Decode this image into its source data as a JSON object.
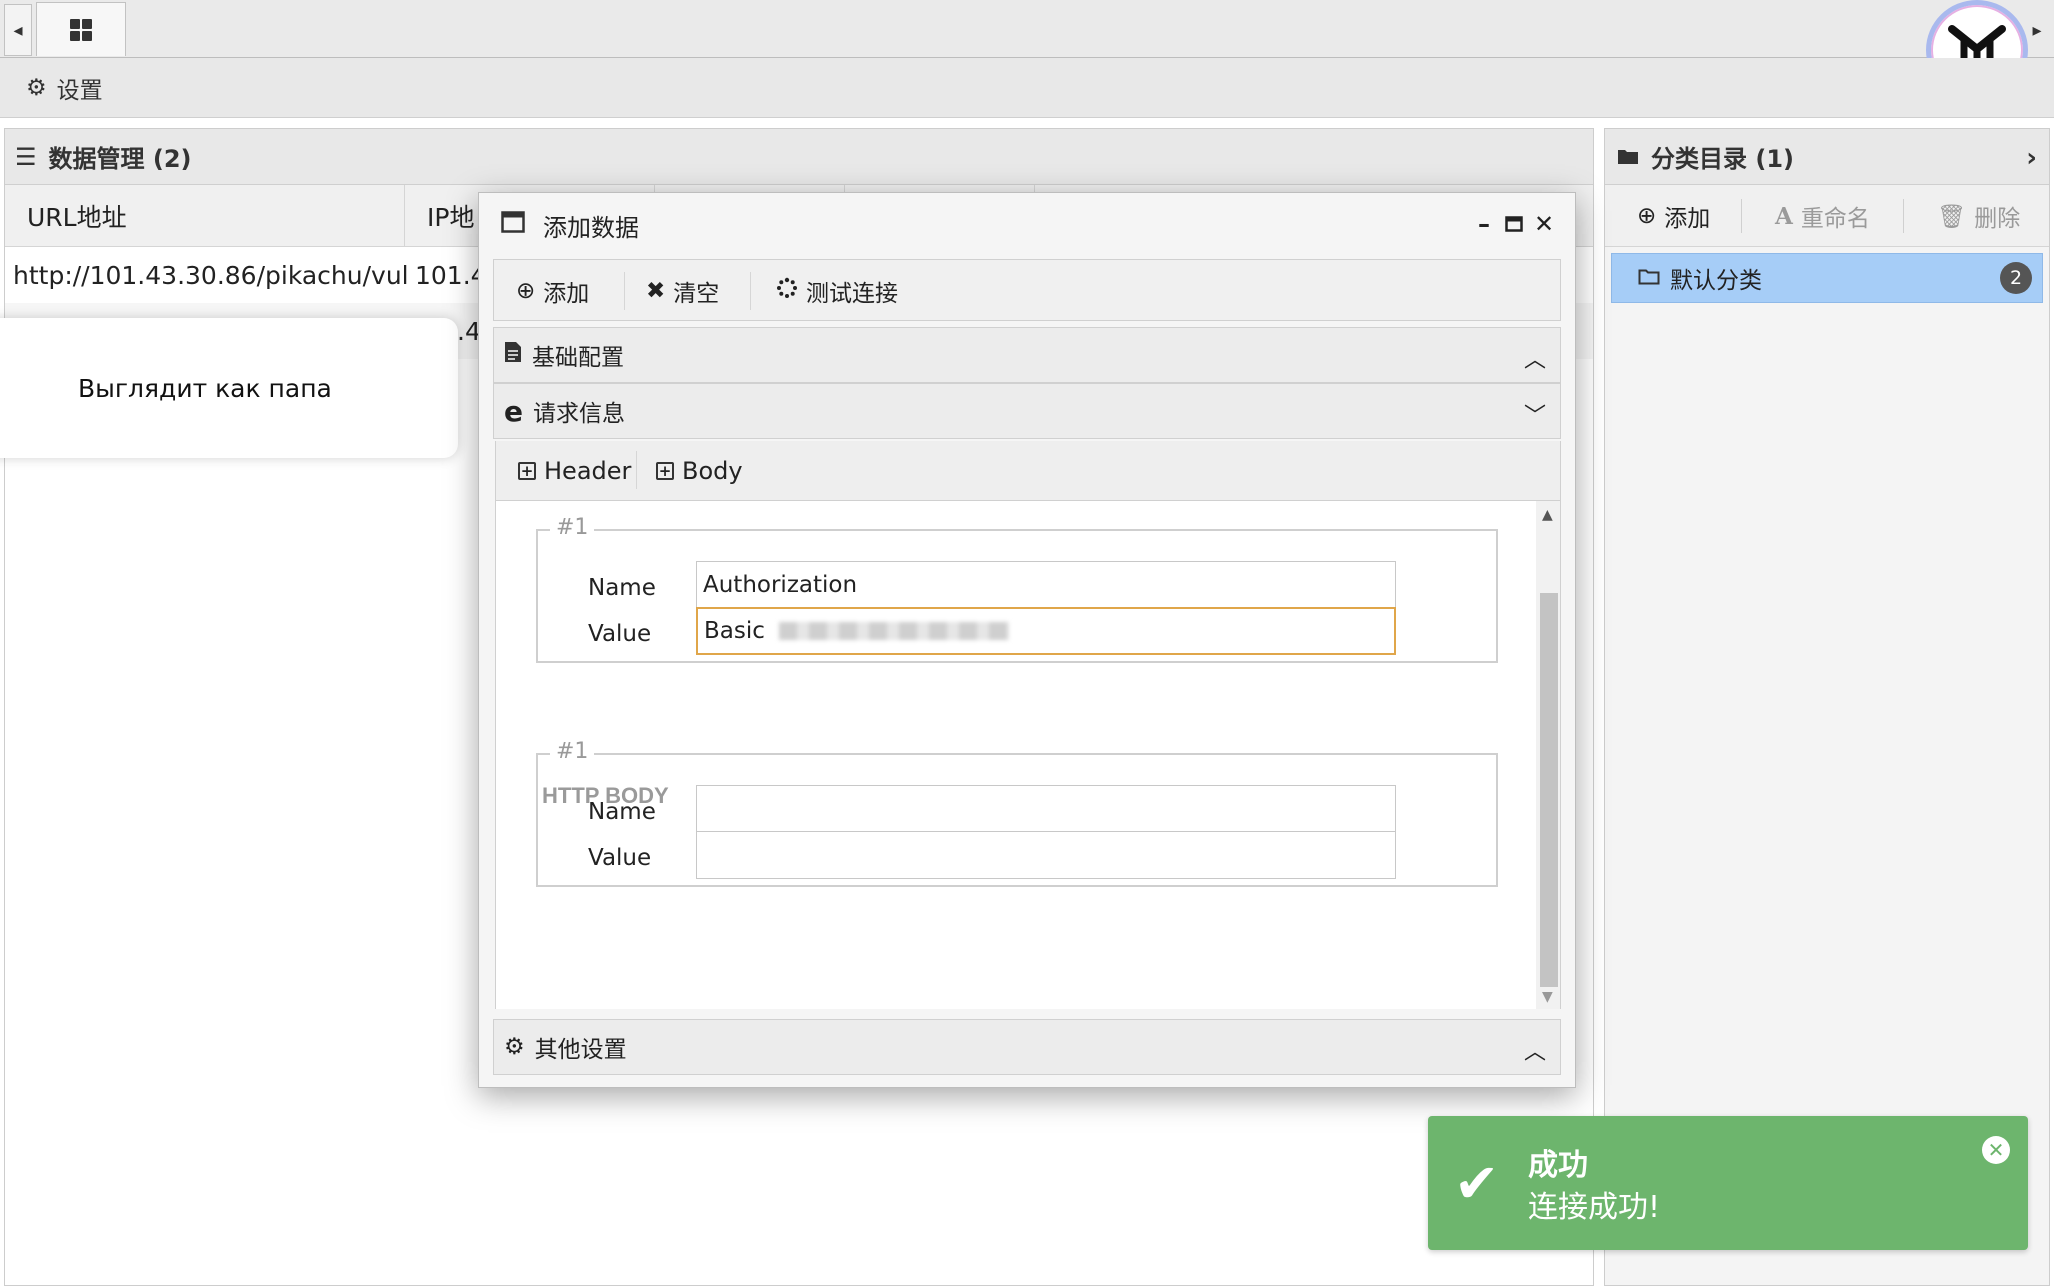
{
  "toolbar": {
    "settings_label": "设置"
  },
  "data_panel": {
    "title": "数据管理 (2)",
    "columns": [
      "URL地址",
      "IP地"
    ],
    "rows": [
      {
        "url": "http://101.43.30.86/pikachu/vul/u",
        "ip": "101.4"
      },
      {
        "url": "",
        "ip": ".4"
      }
    ]
  },
  "tooltip": {
    "text": "Выглядит как папа"
  },
  "category_panel": {
    "title": "分类目录 (1)",
    "add_label": "添加",
    "rename_label": "重命名",
    "delete_label": "删除",
    "items": [
      {
        "label": "默认分类",
        "count": "2"
      }
    ]
  },
  "dialog": {
    "title": "添加数据",
    "toolbar": {
      "add": "添加",
      "clear": "清空",
      "test": "测试连接"
    },
    "sections": {
      "basic": "基础配置",
      "request": "请求信息",
      "other": "其他设置"
    },
    "subtabs": {
      "header": "Header",
      "body": "Body"
    },
    "header_fields": {
      "legend": "#1",
      "name_label": "Name",
      "value_label": "Value",
      "name_value": "Authorization",
      "value_value": "Basic"
    },
    "body_title": "HTTP BODY",
    "body_fields": {
      "legend": "#1",
      "name_label": "Name",
      "value_label": "Value",
      "name_value": "",
      "value_value": ""
    }
  },
  "toast": {
    "title": "成功",
    "message": "连接成功!"
  },
  "colors": {
    "accent": "#a6cdf7",
    "success": "#6db56d",
    "focus": "#e0a64a"
  }
}
